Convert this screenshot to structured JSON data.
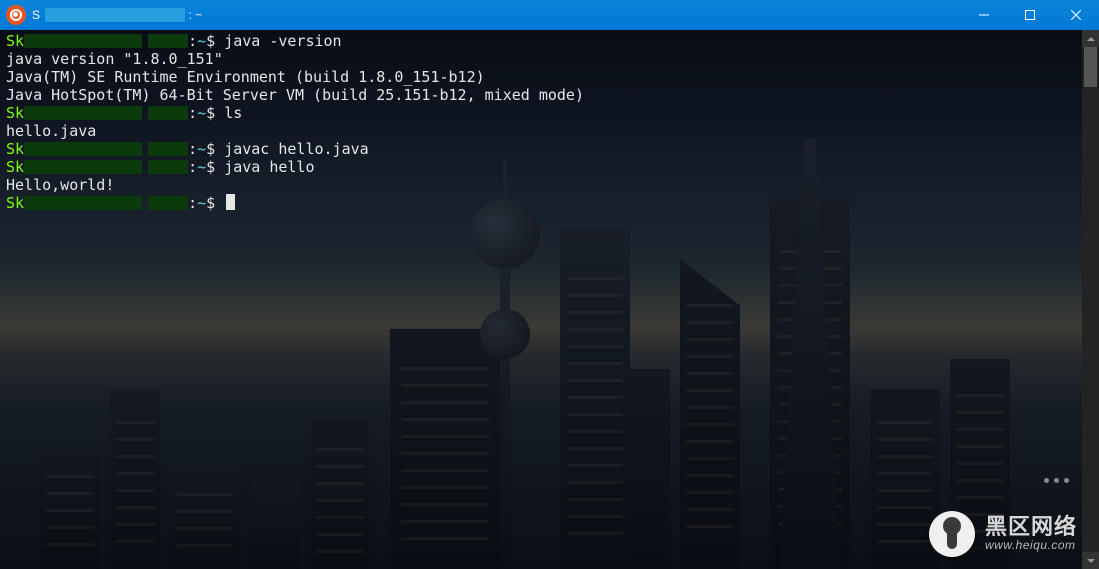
{
  "titlebar": {
    "prefix": "S",
    "suffix": ": ~"
  },
  "terminal": {
    "lines": [
      {
        "prompt_user": "Sk",
        "prompt_mid": ":",
        "prompt_tilde": "~",
        "prompt_end": "$ ",
        "cmd": "java -version"
      },
      {
        "out": "java version \"1.8.0_151\""
      },
      {
        "out": "Java(TM) SE Runtime Environment (build 1.8.0_151-b12)"
      },
      {
        "out": "Java HotSpot(TM) 64-Bit Server VM (build 25.151-b12, mixed mode)"
      },
      {
        "prompt_user": "Sk",
        "prompt_mid": ":",
        "prompt_tilde": "~",
        "prompt_end": "$ ",
        "cmd": "ls"
      },
      {
        "out": "hello.java"
      },
      {
        "prompt_user": "Sk",
        "prompt_mid": ":",
        "prompt_tilde": "~",
        "prompt_end": "$ ",
        "cmd": "javac hello.java"
      },
      {
        "prompt_user": "Sk",
        "prompt_mid": ":",
        "prompt_tilde": "~",
        "prompt_end": "$ ",
        "cmd": "java hello"
      },
      {
        "out": "Hello,world!"
      },
      {
        "prompt_user": "Sk",
        "prompt_mid": ":",
        "prompt_tilde": "~",
        "prompt_end": "$ ",
        "cmd": "",
        "cursor": true
      }
    ]
  },
  "watermark": {
    "name": "黑区网络",
    "url": "www.heiqu.com"
  }
}
